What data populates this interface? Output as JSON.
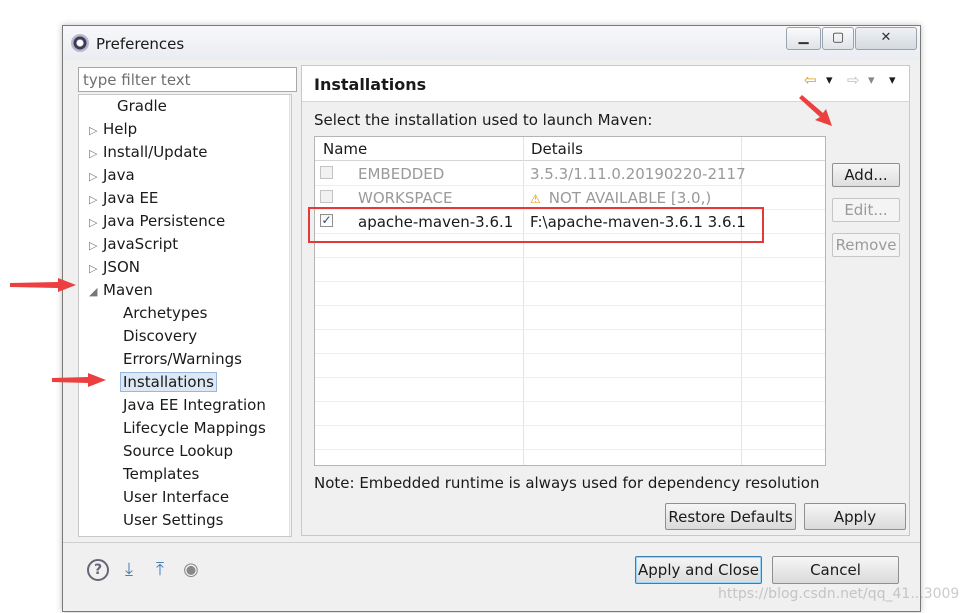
{
  "window": {
    "title": "Preferences",
    "min_glyph": "▁",
    "max_glyph": "▢",
    "close_glyph": "✕"
  },
  "filter": {
    "placeholder": "type filter text"
  },
  "tree": {
    "items": [
      {
        "label": "Gradle",
        "twisty": ""
      },
      {
        "label": "Help",
        "twisty": "▷"
      },
      {
        "label": "Install/Update",
        "twisty": "▷"
      },
      {
        "label": "Java",
        "twisty": "▷"
      },
      {
        "label": "Java EE",
        "twisty": "▷"
      },
      {
        "label": "Java Persistence",
        "twisty": "▷"
      },
      {
        "label": "JavaScript",
        "twisty": "▷"
      },
      {
        "label": "JSON",
        "twisty": "▷"
      },
      {
        "label": "Maven",
        "twisty": "◢"
      },
      {
        "label": "Archetypes"
      },
      {
        "label": "Discovery"
      },
      {
        "label": "Errors/Warnings"
      },
      {
        "label": "Installations"
      },
      {
        "label": "Java EE Integration"
      },
      {
        "label": "Lifecycle Mappings"
      },
      {
        "label": "Source Lookup"
      },
      {
        "label": "Templates"
      },
      {
        "label": "User Interface"
      },
      {
        "label": "User Settings"
      }
    ],
    "scroll_up": "▲",
    "scroll_down": "▼",
    "scroll_grip": "≡"
  },
  "panel": {
    "title": "Installations",
    "nav": {
      "back": "⇦",
      "back_menu": "▾",
      "forward": "⇨",
      "forward_menu": "▾",
      "menu": "▾"
    },
    "select_text": "Select the installation used to launch Maven:",
    "table": {
      "headers": {
        "name": "Name",
        "details": "Details"
      },
      "rows": [
        {
          "name": "EMBEDDED",
          "details": "3.5.3/1.11.0.20190220-2117",
          "checked": "",
          "warn": ""
        },
        {
          "name": "WORKSPACE",
          "details": "NOT AVAILABLE [3.0,)",
          "checked": "",
          "warn": "⚠"
        },
        {
          "name": "apache-maven-3.6.1",
          "details": "F:\\apache-maven-3.6.1 3.6.1",
          "checked": "✓",
          "warn": ""
        }
      ]
    },
    "buttons": {
      "add": "Add...",
      "edit": "Edit...",
      "remove": "Remove"
    },
    "note": "Note: Embedded runtime is always used for dependency resolution",
    "restore_defaults": "Restore Defaults",
    "apply": "Apply"
  },
  "footer": {
    "help_icon": "?",
    "import_icon": "⤓",
    "export_icon": "⤒",
    "record_icon": "◉",
    "apply_close": "Apply and Close",
    "cancel": "Cancel"
  },
  "colors": {
    "annotation_red": "#e23a3a",
    "selection_blue": "#dde8f5",
    "default_button_border": "#3c7fb1"
  },
  "watermark": "https://blog.csdn.net/qq_41...3009"
}
